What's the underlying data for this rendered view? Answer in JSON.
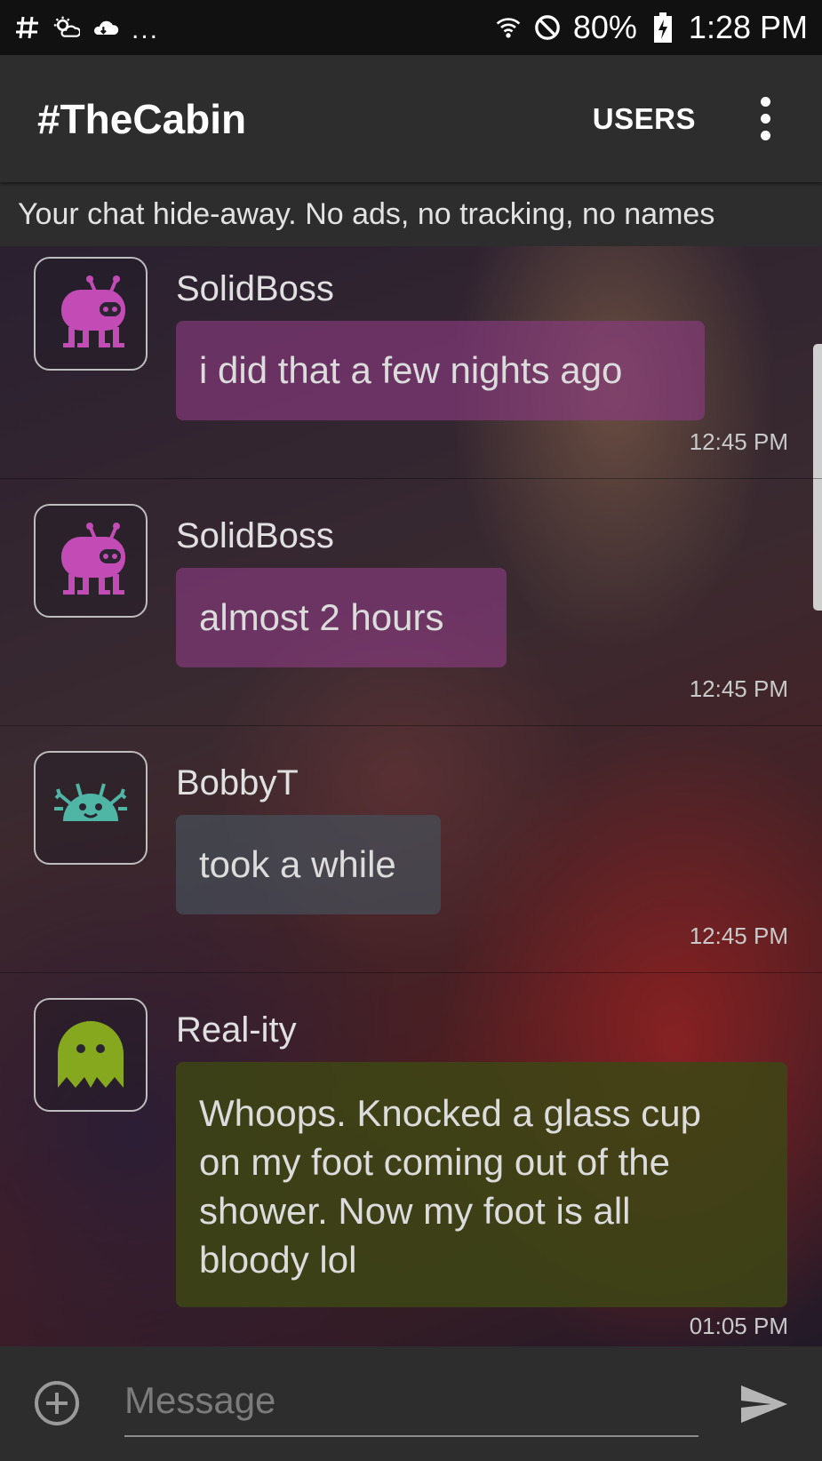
{
  "status_bar": {
    "icons_left": [
      "network-hash-icon",
      "weather-icon",
      "cloud-sync-icon"
    ],
    "more": "...",
    "battery": "80%",
    "time": "1:28 PM",
    "icons_right": [
      "wifi-icon",
      "do-not-disturb-icon",
      "battery-charging-icon"
    ]
  },
  "app_bar": {
    "title": "#TheCabin",
    "users_label": "USERS"
  },
  "topic": "Your chat hide-away.  No ads, no tracking, no names",
  "messages": [
    {
      "user": "SolidBoss",
      "text": "i did that a few nights ago",
      "time": "12:45 PM",
      "avatar": "pink-robot-avatar",
      "color": "#c24bb5"
    },
    {
      "user": "SolidBoss",
      "text": "almost 2 hours",
      "time": "12:45 PM",
      "avatar": "pink-robot-avatar",
      "color": "#c24bb5"
    },
    {
      "user": "BobbyT",
      "text": "took a while",
      "time": "12:45 PM",
      "avatar": "teal-bug-avatar",
      "color": "#4fb6a6"
    },
    {
      "user": "Real-ity",
      "text": "Whoops.  Knocked a glass cup on my foot coming out of the shower.  Now my foot is all bloody lol",
      "lines": [
        "Whoops.  Knocked a glass cup",
        "on my foot coming out of the",
        "shower.  Now my foot is all",
        "bloody lol"
      ],
      "time": "01:05 PM",
      "avatar": "green-ghost-avatar",
      "color": "#86a81f"
    }
  ],
  "composer": {
    "placeholder": "Message"
  }
}
